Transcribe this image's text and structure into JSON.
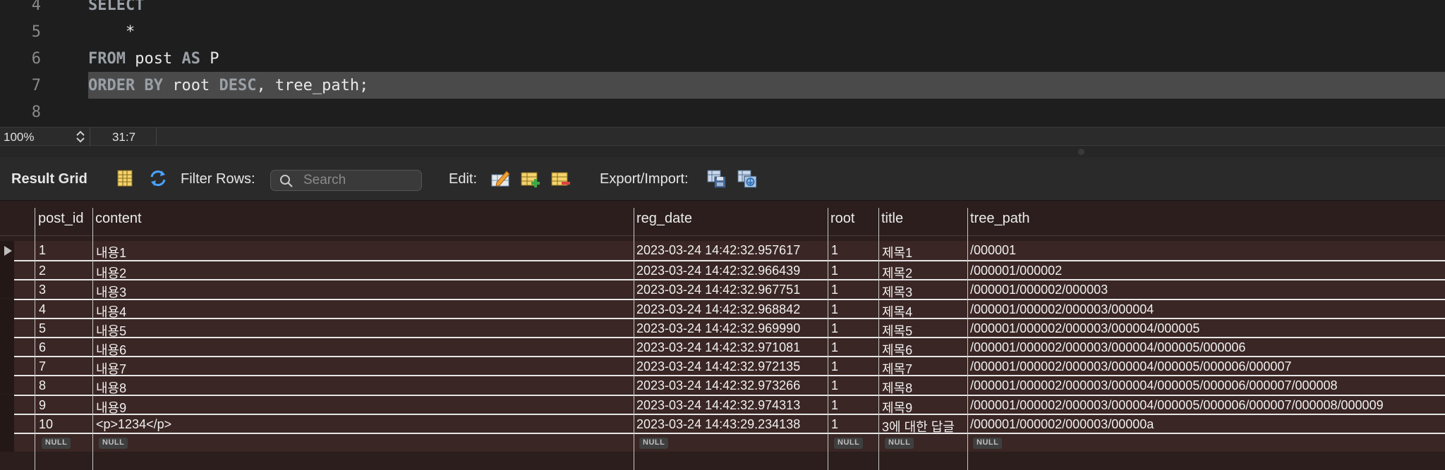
{
  "editor": {
    "lines": [
      {
        "num": "4",
        "kw": "SELECT",
        "rest": ""
      },
      {
        "num": "5",
        "kw": "",
        "rest": "    *"
      },
      {
        "num": "6",
        "kw": "FROM",
        "rest": " post ",
        "kw2": "AS",
        "rest2": " P"
      },
      {
        "num": "7",
        "kw": "ORDER BY",
        "rest": " root ",
        "kw2": "DESC",
        "rest2": ", tree_path;"
      },
      {
        "num": "8",
        "kw": "",
        "rest": ""
      }
    ]
  },
  "status": {
    "zoom": "100%",
    "cursor": "31:7"
  },
  "toolbar": {
    "result_grid_label": "Result Grid",
    "filter_rows_label": "Filter Rows:",
    "search_placeholder": "Search",
    "edit_label": "Edit:",
    "export_import_label": "Export/Import:"
  },
  "grid": {
    "columns": [
      "post_id",
      "content",
      "reg_date",
      "root",
      "title",
      "tree_path"
    ],
    "rows": [
      [
        "1",
        "내용1",
        "2023-03-24 14:42:32.957617",
        "1",
        "제목1",
        "/000001"
      ],
      [
        "2",
        "내용2",
        "2023-03-24 14:42:32.966439",
        "1",
        "제목2",
        "/000001/000002"
      ],
      [
        "3",
        "내용3",
        "2023-03-24 14:42:32.967751",
        "1",
        "제목3",
        "/000001/000002/000003"
      ],
      [
        "4",
        "내용4",
        "2023-03-24 14:42:32.968842",
        "1",
        "제목4",
        "/000001/000002/000003/000004"
      ],
      [
        "5",
        "내용5",
        "2023-03-24 14:42:32.969990",
        "1",
        "제목5",
        "/000001/000002/000003/000004/000005"
      ],
      [
        "6",
        "내용6",
        "2023-03-24 14:42:32.971081",
        "1",
        "제목6",
        "/000001/000002/000003/000004/000005/000006"
      ],
      [
        "7",
        "내용7",
        "2023-03-24 14:42:32.972135",
        "1",
        "제목7",
        "/000001/000002/000003/000004/000005/000006/000007"
      ],
      [
        "8",
        "내용8",
        "2023-03-24 14:42:32.973266",
        "1",
        "제목8",
        "/000001/000002/000003/000004/000005/000006/000007/000008"
      ],
      [
        "9",
        "내용9",
        "2023-03-24 14:42:32.974313",
        "1",
        "제목9",
        "/000001/000002/000003/000004/000005/000006/000007/000008/000009"
      ],
      [
        "10",
        "<p>1234</p>",
        "2023-03-24 14:43:29.234138",
        "1",
        "3에 대한 답글",
        "/000001/000002/000003/00000a"
      ]
    ],
    "null_label": "NULL"
  },
  "colors": {
    "editor_bg": "#1e1e1e",
    "selection": "#4a4a4a",
    "grid_bg": "#2b1e1c",
    "row_bg": "#3a2624",
    "breakpoint": "#3c8fe6"
  },
  "icons": [
    "breakpoint-dot-icon",
    "chevron-updown-icon",
    "grid-view-icon",
    "refresh-icon",
    "search-icon",
    "edit-cell-icon",
    "add-row-icon",
    "delete-row-icon",
    "export-icon",
    "import-icon",
    "current-row-arrow-icon"
  ]
}
